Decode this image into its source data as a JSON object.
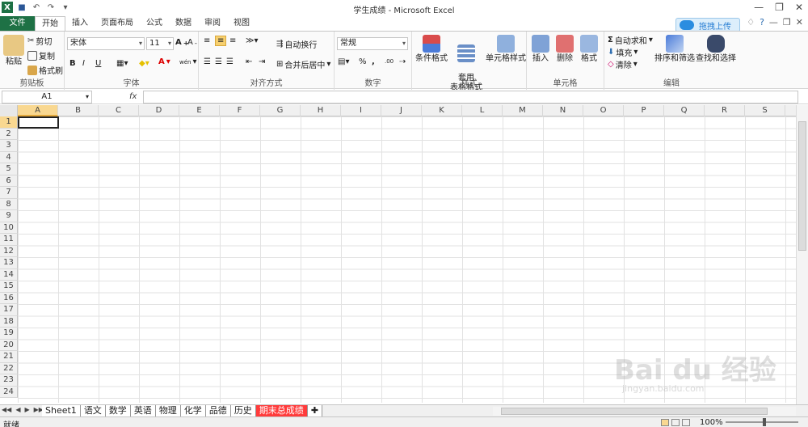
{
  "window": {
    "title": "学生成绩 - Microsoft Excel"
  },
  "ribbon_tabs": [
    "文件",
    "开始",
    "插入",
    "页面布局",
    "公式",
    "数据",
    "审阅",
    "视图"
  ],
  "upload_button": "拖拽上传",
  "clipboard": {
    "paste": "粘贴",
    "cut": "剪切",
    "copy": "复制",
    "format_painter": "格式刷",
    "label": "剪贴板"
  },
  "font": {
    "font_name": "宋体",
    "font_size": "11",
    "bold": "B",
    "italic": "I",
    "underline": "U",
    "label": "字体",
    "phonetic": "wén",
    "font_color_glyph": "A"
  },
  "alignment": {
    "wrap_text": "自动换行",
    "merge_center": "合并后居中",
    "label": "对齐方式"
  },
  "number": {
    "format": "常规",
    "percent": "%",
    "comma": ",",
    "inc_decimal": ".00",
    "label": "数字"
  },
  "styles": {
    "conditional": "条件格式",
    "table_format": "套用\n表格格式",
    "cell_styles": "单元格样式",
    "label": "样式"
  },
  "cells": {
    "insert": "插入",
    "delete": "删除",
    "format": "格式",
    "label": "单元格"
  },
  "editing": {
    "autosum": "自动求和",
    "fill": "填充",
    "clear": "清除",
    "sort_filter": "排序和筛选",
    "find_select": "查找和选择",
    "label": "编辑"
  },
  "formula_bar": {
    "name_box": "A1",
    "fx": "fx",
    "value": ""
  },
  "columns": [
    "A",
    "B",
    "C",
    "D",
    "E",
    "F",
    "G",
    "H",
    "I",
    "J",
    "K",
    "L",
    "M",
    "N",
    "O",
    "P",
    "Q",
    "R",
    "S"
  ],
  "rows": [
    "1",
    "2",
    "3",
    "4",
    "5",
    "6",
    "7",
    "8",
    "9",
    "10",
    "11",
    "12",
    "13",
    "14",
    "15",
    "16",
    "17",
    "18",
    "19",
    "20",
    "21",
    "22",
    "23",
    "24"
  ],
  "selected_cell": "A1",
  "sheets": [
    "Sheet1",
    "语文",
    "数学",
    "英语",
    "物理",
    "化学",
    "品德",
    "历史",
    "期末总成绩"
  ],
  "active_sheet_highlight": "期末总成绩",
  "status": {
    "ready": "就绪",
    "zoom": "100%"
  },
  "colors": {
    "file_tab": "#1e7145",
    "selection_header": "#f9d891",
    "red_sheet_tab": "#ff3b3b"
  },
  "watermark": {
    "brand": "Bai du 经验",
    "url": "jingyan.baidu.com"
  }
}
